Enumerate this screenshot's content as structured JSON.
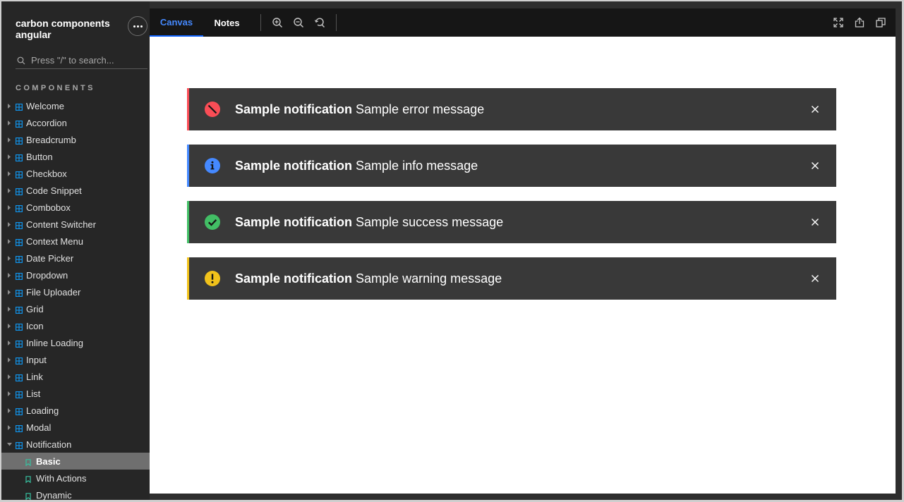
{
  "app": {
    "title": "carbon components angular"
  },
  "search": {
    "placeholder": "Press \"/\" to search..."
  },
  "sidebar": {
    "section": "COMPONENTS",
    "items": [
      {
        "label": "Welcome",
        "type": "component",
        "expanded": false
      },
      {
        "label": "Accordion",
        "type": "component",
        "expanded": false
      },
      {
        "label": "Breadcrumb",
        "type": "component",
        "expanded": false
      },
      {
        "label": "Button",
        "type": "component",
        "expanded": false
      },
      {
        "label": "Checkbox",
        "type": "component",
        "expanded": false
      },
      {
        "label": "Code Snippet",
        "type": "component",
        "expanded": false
      },
      {
        "label": "Combobox",
        "type": "component",
        "expanded": false
      },
      {
        "label": "Content Switcher",
        "type": "component",
        "expanded": false
      },
      {
        "label": "Context Menu",
        "type": "component",
        "expanded": false
      },
      {
        "label": "Date Picker",
        "type": "component",
        "expanded": false
      },
      {
        "label": "Dropdown",
        "type": "component",
        "expanded": false
      },
      {
        "label": "File Uploader",
        "type": "component",
        "expanded": false
      },
      {
        "label": "Grid",
        "type": "component",
        "expanded": false
      },
      {
        "label": "Icon",
        "type": "component",
        "expanded": false
      },
      {
        "label": "Inline Loading",
        "type": "component",
        "expanded": false
      },
      {
        "label": "Input",
        "type": "component",
        "expanded": false
      },
      {
        "label": "Link",
        "type": "component",
        "expanded": false
      },
      {
        "label": "List",
        "type": "component",
        "expanded": false
      },
      {
        "label": "Loading",
        "type": "component",
        "expanded": false
      },
      {
        "label": "Modal",
        "type": "component",
        "expanded": false
      },
      {
        "label": "Notification",
        "type": "component",
        "expanded": true
      },
      {
        "label": "Basic",
        "type": "story",
        "selected": true
      },
      {
        "label": "With Actions",
        "type": "story",
        "selected": false
      },
      {
        "label": "Dynamic",
        "type": "story",
        "selected": false
      }
    ]
  },
  "toolbar": {
    "tabs": [
      {
        "label": "Canvas",
        "active": true
      },
      {
        "label": "Notes",
        "active": false
      }
    ],
    "icons": [
      "zoom-in-icon",
      "zoom-out-icon",
      "reset-zoom-icon",
      "fullscreen-icon",
      "share-icon",
      "copy-link-icon"
    ]
  },
  "notifications": [
    {
      "kind": "error",
      "title": "Sample notification",
      "message": "Sample error message",
      "color": "#fa4d56"
    },
    {
      "kind": "info",
      "title": "Sample notification",
      "message": "Sample info message",
      "color": "#4589ff"
    },
    {
      "kind": "success",
      "title": "Sample notification",
      "message": "Sample success message",
      "color": "#42be65"
    },
    {
      "kind": "warning",
      "title": "Sample notification",
      "message": "Sample warning message",
      "color": "#f1c21b"
    }
  ],
  "colors": {
    "sidebar_bg": "#262626",
    "toolbar_bg": "#161616",
    "accent": "#0f62fe",
    "notification_bg": "#393939"
  }
}
